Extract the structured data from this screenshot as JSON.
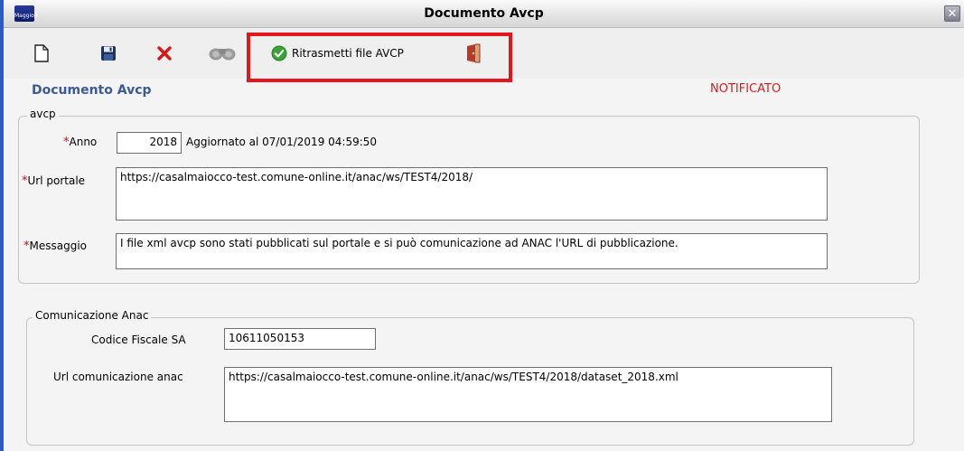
{
  "window": {
    "title": "Documento Avcp",
    "app_icon_text": "Maggioli",
    "close_label": "✕"
  },
  "toolbar": {
    "new_icon": "new-document-icon",
    "save_icon": "save-disk-icon",
    "delete_icon": "delete-x-icon",
    "search_icon": "binoculars-icon",
    "retransmit_label": "Ritrasmetti file AVCP",
    "retransmit_icon": "green-check-icon",
    "exit_icon": "exit-door-icon"
  },
  "header": {
    "title": "Documento Avcp",
    "status": "NOTIFICATO"
  },
  "avcp": {
    "legend": "avcp",
    "required_mark": "*",
    "anno_label": "Anno",
    "anno_value": "2018",
    "updated_text": "Aggiornato al 07/01/2019 04:59:50",
    "url_label": "Url portale",
    "url_value": "https://casalmaiocco-test.comune-online.it/anac/ws/TEST4/2018/",
    "messaggio_label": "Messaggio",
    "messaggio_value": "I file xml avcp sono stati pubblicati sul portale e si può comunicazione ad ANAC l'URL di pubblicazione."
  },
  "anac": {
    "legend": "Comunicazione Anac",
    "codice_label": "Codice Fiscale SA",
    "codice_value": "10611050153",
    "url_label": "Url comunicazione anac",
    "url_value": "https://casalmaiocco-test.comune-online.it/anac/ws/TEST4/2018/dataset_2018.xml"
  },
  "colors": {
    "heading": "#3c5a96",
    "status": "#d81c1c",
    "required": "#e00000",
    "highlight": "#e3161b"
  }
}
